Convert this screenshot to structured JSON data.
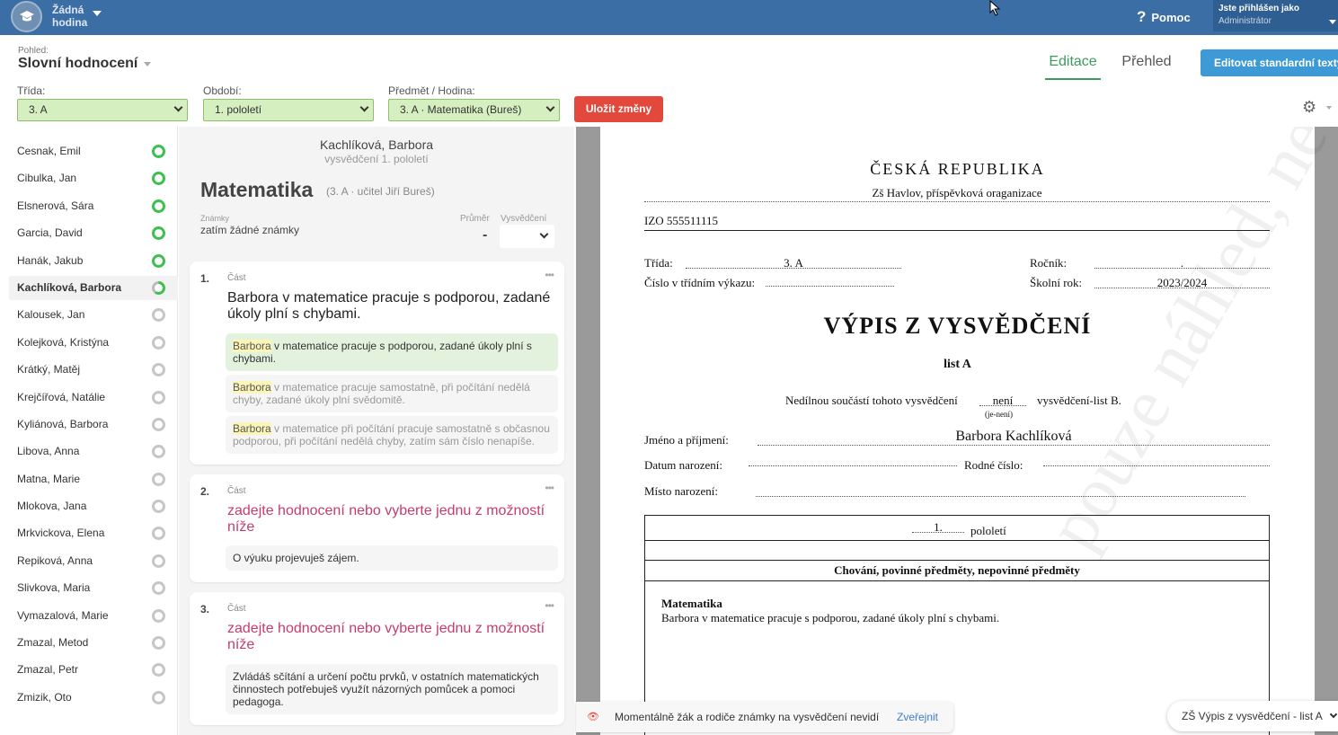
{
  "topbar": {
    "hour_label": "Žádná hodina",
    "help_label": "Pomoc",
    "user_line1": "Jste přihlášen jako",
    "user_line2": "Administrátor"
  },
  "view": {
    "label": "Pohled:",
    "title": "Slovní hodnocení",
    "tab_edit": "Editace",
    "tab_overview": "Přehled",
    "edit_texts_button": "Editovat standardní texty"
  },
  "filters": {
    "class_label": "Třída:",
    "class_value": "3. A",
    "period_label": "Období:",
    "period_value": "1. pololetí",
    "subject_label": "Předmět / Hodina:",
    "subject_value": "3. A · Matematika (Bureš)",
    "save_button": "Uložit změny"
  },
  "students": [
    {
      "name": "Cesnak, Emil",
      "status": "g"
    },
    {
      "name": "Cibulka, Jan",
      "status": "g"
    },
    {
      "name": "Elsnerová, Sára",
      "status": "g"
    },
    {
      "name": "Garcia, David",
      "status": "g"
    },
    {
      "name": "Hanák, Jakub",
      "status": "g"
    },
    {
      "name": "Kachlíková, Barbora",
      "status": "gh",
      "selected": true
    },
    {
      "name": "Kalousek, Jan",
      "status": "gr"
    },
    {
      "name": "Kolejková, Kristýna",
      "status": "gr"
    },
    {
      "name": "Krátký, Matěj",
      "status": "gr"
    },
    {
      "name": "Krejčířová, Natálie",
      "status": "gr"
    },
    {
      "name": "Kyliánová, Barbora",
      "status": "gr"
    },
    {
      "name": "Libova, Anna",
      "status": "gr"
    },
    {
      "name": "Matna, Marie",
      "status": "gr"
    },
    {
      "name": "Mlokova, Jana",
      "status": "gr"
    },
    {
      "name": "Mrkvickova, Elena",
      "status": "gr"
    },
    {
      "name": "Repiková, Anna",
      "status": "gr"
    },
    {
      "name": "Slivkova, Maria",
      "status": "gr"
    },
    {
      "name": "Vymazalová, Marie",
      "status": "gr"
    },
    {
      "name": "Zmazal, Metod",
      "status": "gr"
    },
    {
      "name": "Zmazal, Petr",
      "status": "gr"
    },
    {
      "name": "Zmizik, Oto",
      "status": "gr"
    }
  ],
  "editor": {
    "student_name": "Kachlíková, Barbora",
    "subtitle": "vysvědčení 1. pololetí",
    "subject": "Matematika",
    "subject_meta": "(3. A · učitel Jiří Bureš)",
    "marks_label": "Známky",
    "marks_value": "zatím žádné známky",
    "avg_label": "Průměr",
    "avg_value": "-",
    "cert_label": "Vysvědčení",
    "part_label": "Část",
    "card1_num": "1.",
    "card1_text": "Barbora v matematice pracuje s podporou, zadané úkoly plní s chybami.",
    "card1_opt1_hl": "Barbora",
    "card1_opt1_rest": " v matematice pracuje s podporou, zadané úkoly plní s chybami.",
    "card1_opt2_hl": "Barbora",
    "card1_opt2_rest": " v matematice pracuje samostatně, při počítání nedělá chyby, zadané úkoly plní svědomitě.",
    "card1_opt3_hl": "Barbora",
    "card1_opt3_rest": " v matematice při počítání pracuje samostatně s občasnou podporou, při počítání nedělá chyby, zatím sám číslo nenapíše.",
    "card2_num": "2.",
    "card2_placeholder": "zadejte hodnocení nebo vyberte jednu z možností níže",
    "card2_opt1": "O výuku projevuješ zájem.",
    "card3_num": "3.",
    "card3_placeholder": "zadejte hodnocení nebo vyberte jednu z možností níže",
    "card3_opt1": "Zvládáš sčítání a určení počtu prvků, v ostatních matematických činnostech potřebuješ využít názorných pomůcek a pomoci pedagoga."
  },
  "preview": {
    "country": "ČESKÁ REPUBLIKA",
    "school": "Zš Havlov, příspěvková oraganizace",
    "izo": "IZO   555511115",
    "class_lbl": "Třída:",
    "class_val": "3. A",
    "year_lbl": "Ročník:",
    "year_val": ".",
    "register_lbl": "Číslo v třídním výkazu:",
    "school_year_lbl": "Školní rok:",
    "school_year_val": "2023/2024",
    "title": "VÝPIS Z VYSVĚDČENÍ",
    "list": "list A",
    "part_text_a": "Nedílnou součástí tohoto vysvědčení",
    "part_val": "není",
    "part_hint": "(je-není)",
    "part_text_b": "vysvědčení-list B.",
    "name_lbl": "Jméno a příjmení:",
    "name_val": "Barbora Kachlíková",
    "birth_lbl": "Datum narození:",
    "id_lbl": "Rodné číslo:",
    "place_lbl": "Místo narození:",
    "term_num": "1.",
    "term_lbl": "pololetí",
    "section_head": "Chování, povinné předměty, nepovinné předměty",
    "subject": "Matematika",
    "subject_text": "Barbora v matematice pracuje s podporou, zadané úkoly plní s chybami.",
    "watermark": "pouze náhled, netisknout"
  },
  "notice": {
    "text": "Momentálně žák a rodiče známky na vysvědčení nevidí",
    "link": "Zveřejnit"
  },
  "template_select": "ZŠ Výpis z vysvědčení - list A"
}
